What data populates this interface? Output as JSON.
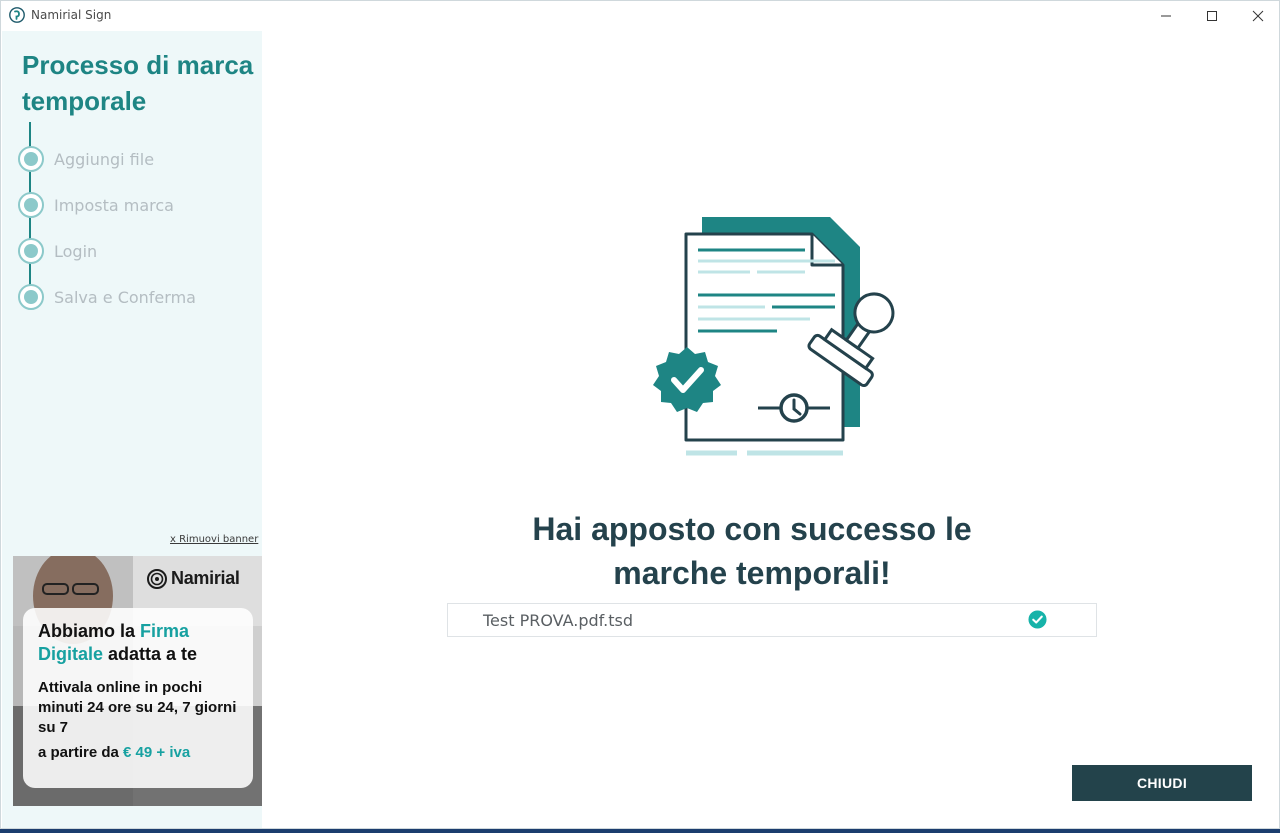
{
  "window": {
    "app_title": "Namirial Sign",
    "app_icon": "namirial-logo-icon",
    "controls": [
      "minimize-icon",
      "maximize-icon",
      "close-icon"
    ]
  },
  "sidebar": {
    "title": "Processo di marca temporale",
    "steps": [
      {
        "label": "Aggiungi file"
      },
      {
        "label": "Imposta marca"
      },
      {
        "label": "Login"
      },
      {
        "label": "Salva e Conferma"
      }
    ],
    "remove_banner": "x Rimuovi banner",
    "banner": {
      "logo": "Namirial",
      "head_part1": "Abbiamo la ",
      "head_highlight1": "Firma",
      "head_highlight2": "Digitale",
      "head_part2": " adatta a te",
      "body": "Attivala online in pochi minuti 24 ore su 24, 7 giorni su 7",
      "price_prefix": "a partire da ",
      "price": "€ 49 + iva"
    }
  },
  "main": {
    "success_title": "Hai apposto con successo le marche temporali!",
    "files": [
      {
        "name": "Test PROVA.pdf.tsd",
        "status_icon": "check-circle-icon"
      }
    ],
    "close_button": "CHIUDI"
  },
  "colors": {
    "accent": "#1e8584",
    "title_dark": "#24424c",
    "button_bg": "#23434b",
    "sidebar_bg": "#eef8f9",
    "step_inactive": "#8cc9ca",
    "success_check": "#17b3a9"
  }
}
